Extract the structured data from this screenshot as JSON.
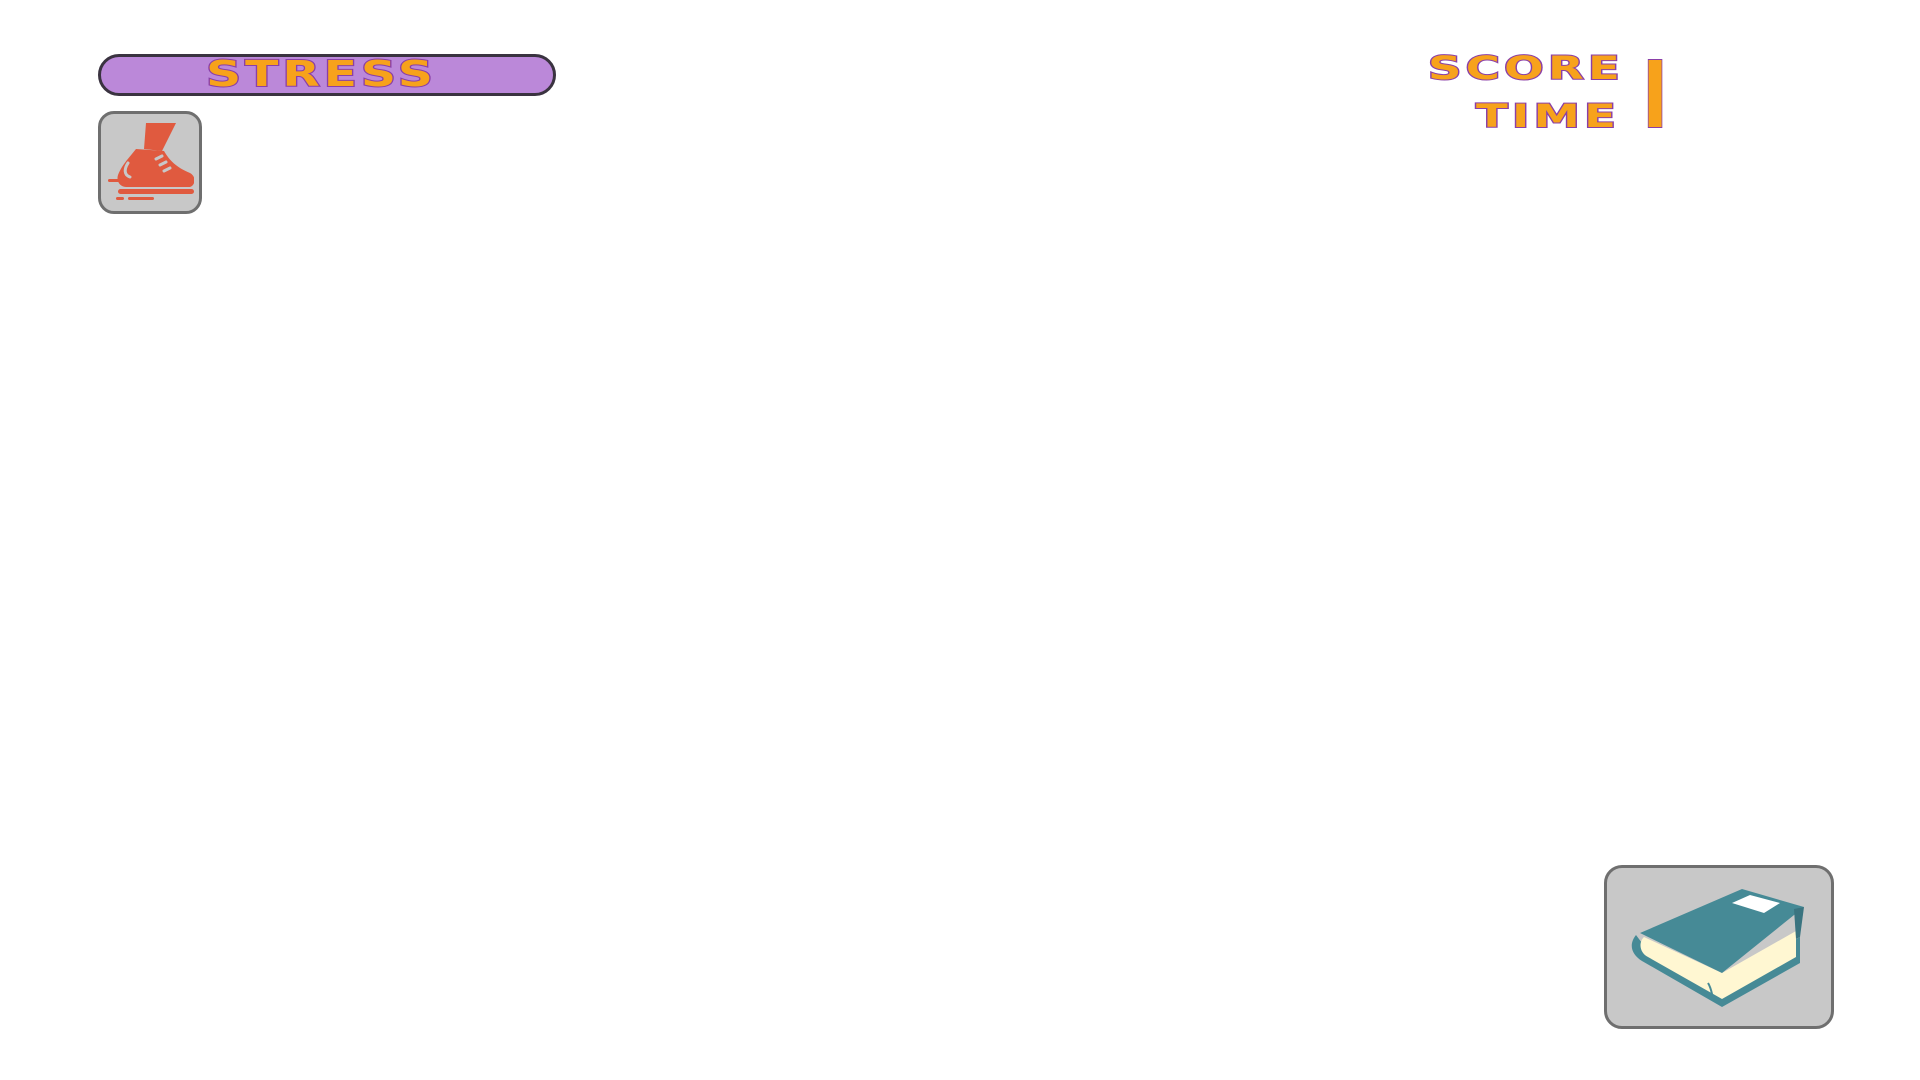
{
  "hud": {
    "stress_label": "STRESS",
    "score_label": "SCORE",
    "time_label": "TIME",
    "value": "I"
  },
  "buttons": {
    "run_icon": "running-shoe-icon",
    "book_icon": "book-icon"
  },
  "colors": {
    "stress_bar_fill": "#bb88d9",
    "text_fill": "#f7a21b",
    "text_outline": "#8a3fa8",
    "button_bg": "#c8c8c8",
    "shoe": "#e05a3f",
    "book_cover": "#468a96",
    "book_pages": "#fff7d2"
  }
}
